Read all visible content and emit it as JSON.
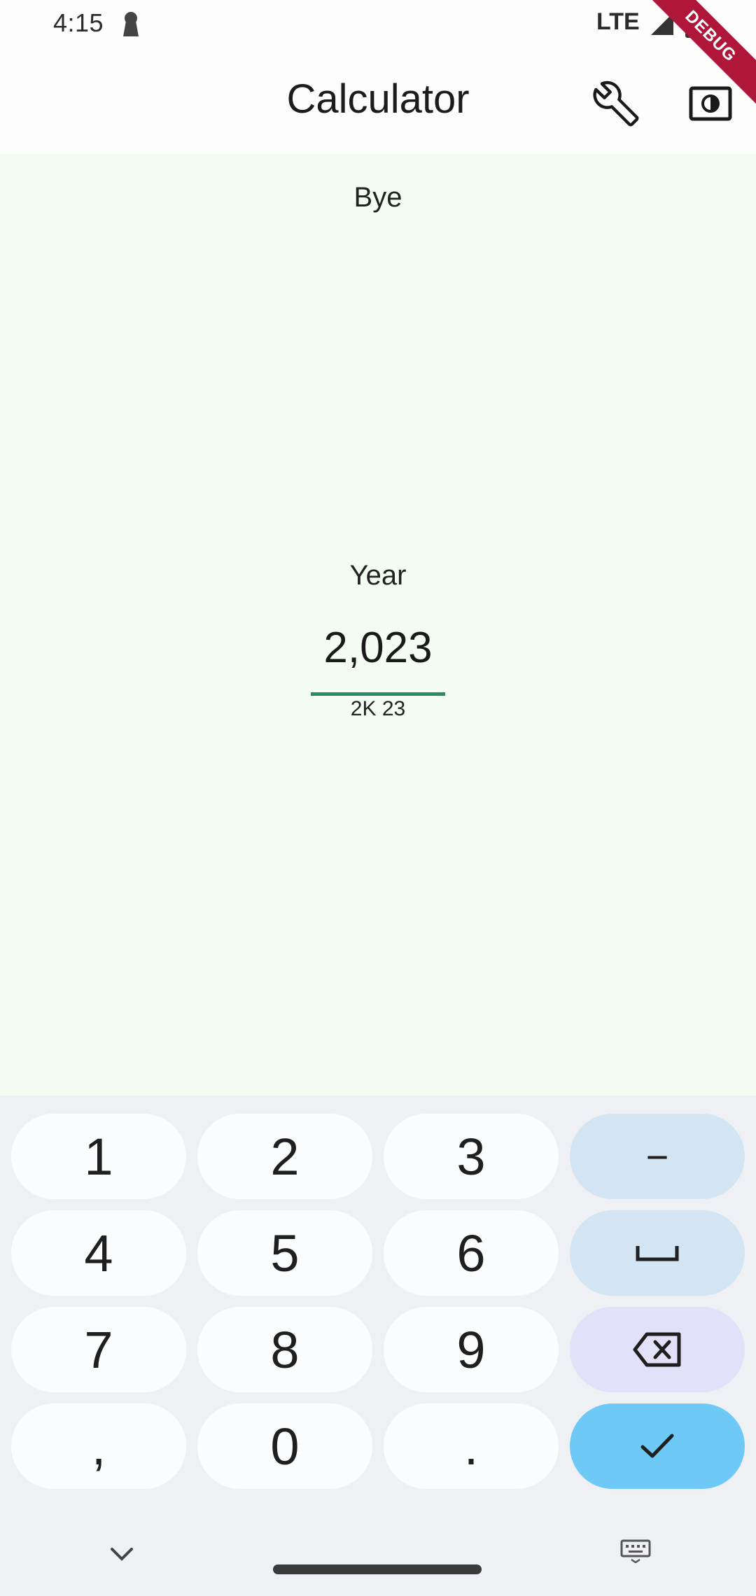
{
  "status_bar": {
    "time": "4:15",
    "network": "LTE"
  },
  "debug_banner": "DEBUG",
  "app_bar": {
    "title": "Calculator",
    "settings_icon": "wrench-icon",
    "theme_icon": "brightness-toggle-icon"
  },
  "main": {
    "other_label": "Bye",
    "field": {
      "label": "Year",
      "value": "2,023",
      "hint": "2K 23"
    }
  },
  "keypad": {
    "row1": [
      "1",
      "2",
      "3",
      "−"
    ],
    "row2": [
      "4",
      "5",
      "6"
    ],
    "row3": [
      "7",
      "8",
      "9"
    ],
    "row4": [
      ",",
      "0",
      "."
    ],
    "space_icon": "space-bar-icon",
    "backspace_icon": "backspace-icon",
    "confirm_icon": "checkmark-icon"
  },
  "nav": {
    "collapse_icon": "chevron-down-icon",
    "keyboard_icon": "keyboard-icon"
  },
  "colors": {
    "background": "#f3fdf1",
    "underline": "#2a8a6a",
    "key_blue": "#d3e4f3",
    "key_purple": "#e3e0fa",
    "key_confirm": "#6ec9f7"
  }
}
